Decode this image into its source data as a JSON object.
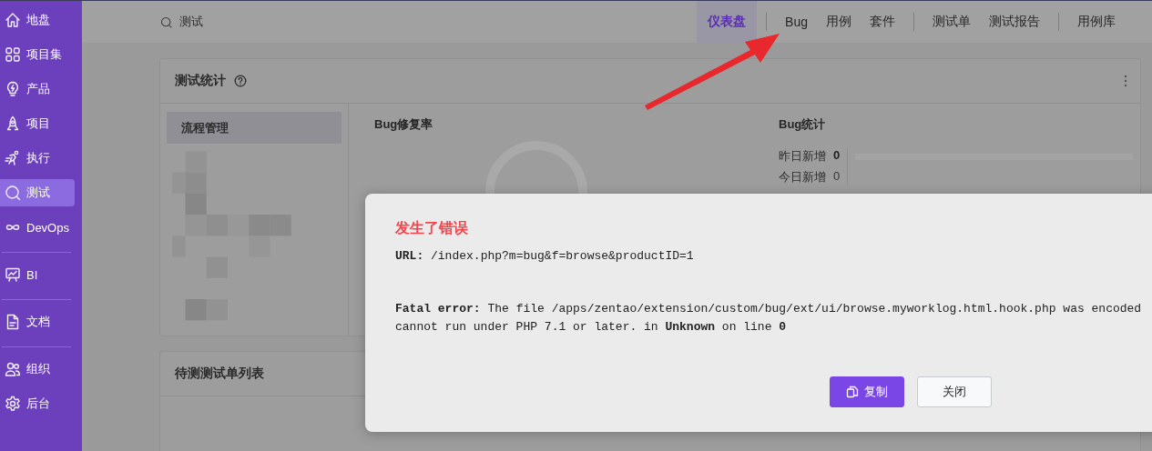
{
  "sidebar": {
    "groups": [
      [
        {
          "label": "地盘",
          "selected": false
        },
        {
          "label": "项目集",
          "selected": false
        },
        {
          "label": "产品",
          "selected": false
        },
        {
          "label": "项目",
          "selected": false
        },
        {
          "label": "执行",
          "selected": false
        },
        {
          "label": "测试",
          "selected": true
        },
        {
          "label": "DevOps",
          "selected": false
        }
      ],
      [
        {
          "label": "BI",
          "selected": false
        }
      ],
      [
        {
          "label": "文档",
          "selected": false
        }
      ],
      [
        {
          "label": "组织",
          "selected": false
        },
        {
          "label": "后台",
          "selected": false
        }
      ]
    ]
  },
  "topbar": {
    "module": "测试",
    "tab_groups": [
      [
        {
          "label": "仪表盘",
          "selected": true
        }
      ],
      [
        {
          "label": "Bug",
          "selected": false
        },
        {
          "label": "用例",
          "selected": false
        },
        {
          "label": "套件",
          "selected": false
        }
      ],
      [
        {
          "label": "测试单",
          "selected": false
        },
        {
          "label": "测试报告",
          "selected": false
        }
      ],
      [
        {
          "label": "用例库",
          "selected": false
        }
      ]
    ]
  },
  "stats_card": {
    "title": "测试统计",
    "products": [
      {
        "label": "流程管理",
        "selected": true
      }
    ],
    "fix_rate": {
      "title": "Bug修复率"
    },
    "bug_stats": {
      "title": "Bug统计",
      "rows": [
        {
          "label": "昨日新增",
          "value": "0",
          "bold": true
        },
        {
          "label": "今日新增",
          "value": "0",
          "bold": false
        }
      ]
    }
  },
  "testtask_card": {
    "title": "待测测试单列表"
  },
  "dialog": {
    "title": "发生了错误",
    "url": "**URL:** /index.php?m=bug&f=browse&productID=1",
    "message": "**Fatal error:** The file /apps/zentao/extension/custom/bug/ext/ui/browse.myworklog.html.hook.php was encoded\ncannot run under PHP 7.1 or later. in **Unknown** on line **0**",
    "buttons": [
      {
        "label": "复制",
        "kind": "primary"
      },
      {
        "label": "关闭",
        "kind": "default"
      }
    ]
  }
}
